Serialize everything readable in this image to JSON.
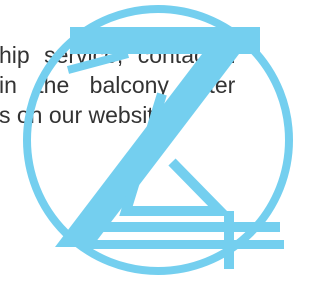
{
  "text_lines": [
    "hip  service,  contact  T",
    "in  the  balcony  after",
    "s on our website."
  ],
  "logo": {
    "icon": "z-monogram-circle-logo",
    "color": "#74cfef"
  },
  "colors": {
    "text": "#333333",
    "background": "#ffffff"
  }
}
